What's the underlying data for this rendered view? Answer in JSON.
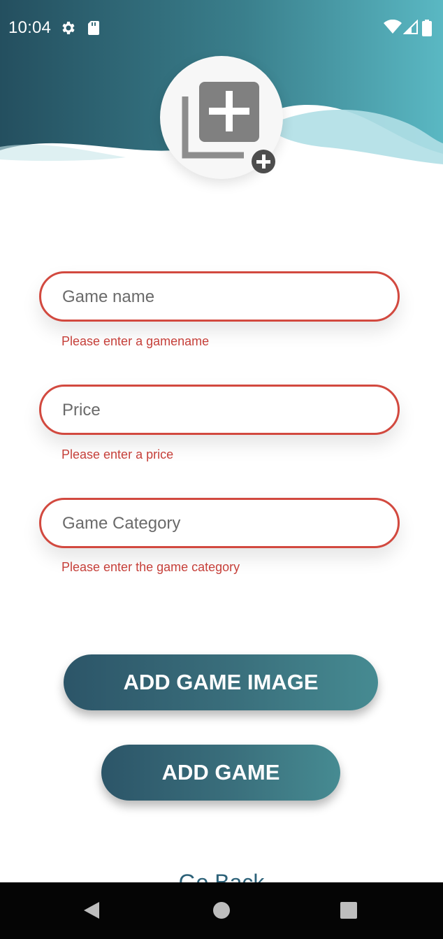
{
  "status_bar": {
    "time": "10:04",
    "icons_left": [
      "settings-icon",
      "sd-card-icon"
    ],
    "icons_right": [
      "wifi-icon",
      "signal-icon",
      "battery-icon"
    ]
  },
  "header": {
    "image_picker_icon": "add-photo-library-icon",
    "colors": {
      "dark_teal": "#2a5a6a",
      "light_teal": "#5ab5c0",
      "wave_light": "#a9dbe2"
    }
  },
  "form": {
    "game_name": {
      "placeholder": "Game name",
      "value": "",
      "error": "Please enter a gamename"
    },
    "price": {
      "placeholder": "Price",
      "value": "",
      "error": "Please enter a price"
    },
    "game_category": {
      "placeholder": "Game Category",
      "value": "",
      "error": "Please enter the game category"
    },
    "error_color": "#c6403a",
    "border_color": "#d2493f"
  },
  "buttons": {
    "add_game_image": "ADD GAME IMAGE",
    "add_game": "ADD GAME",
    "go_back": "Go Back"
  },
  "nav_bar": {
    "icons": [
      "back-triangle-icon",
      "home-circle-icon",
      "recents-square-icon"
    ]
  }
}
